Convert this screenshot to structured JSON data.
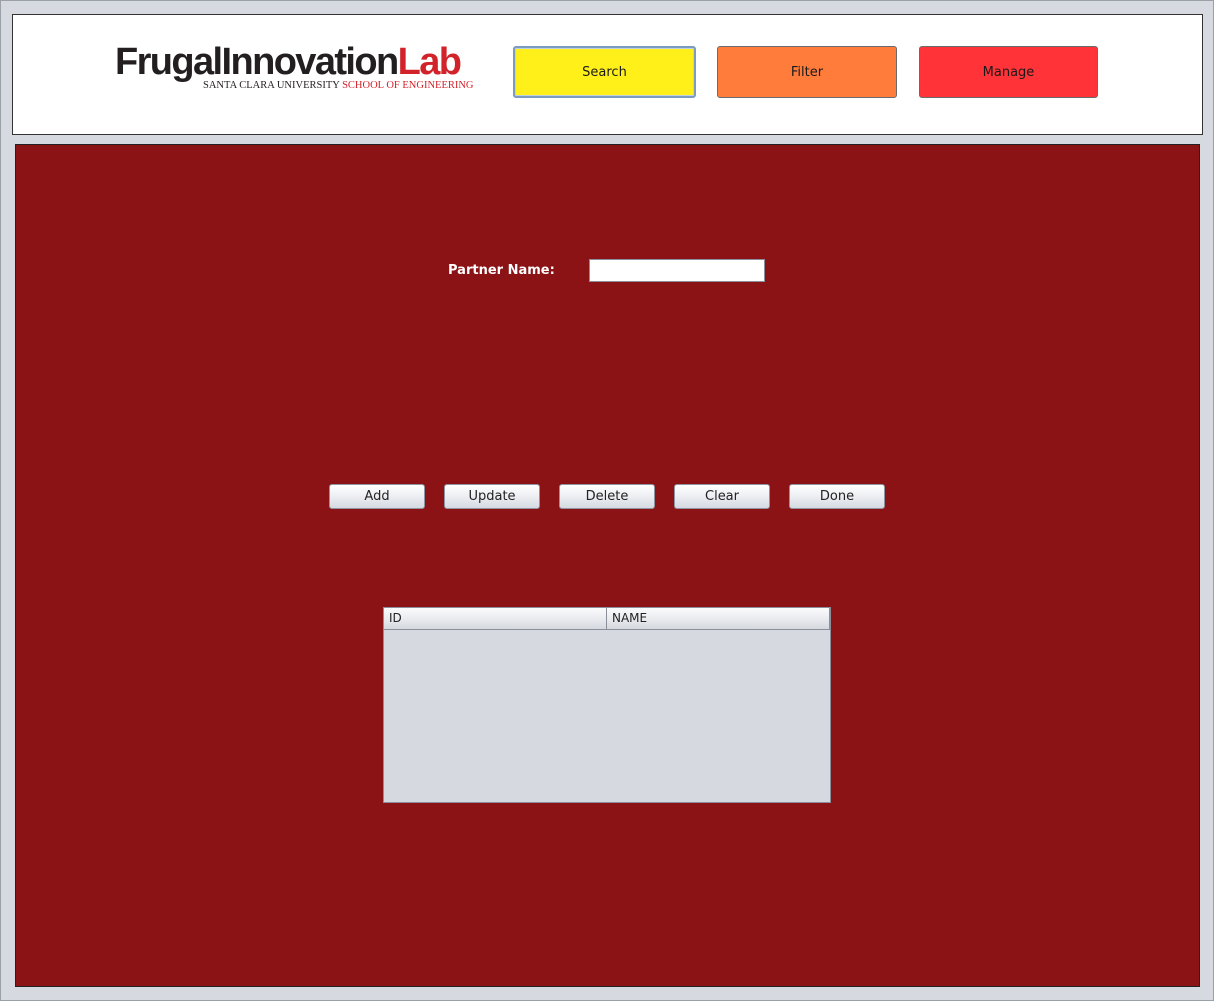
{
  "header": {
    "logo": {
      "main_dark": "Frugal",
      "main_mid": "Innovation",
      "main_red": "Lab",
      "sub_dark": "SANTA CLARA UNIVERSITY",
      "sub_red": "SCHOOL OF ENGINEERING"
    },
    "nav": {
      "search_label": "Search",
      "filter_label": "Filter",
      "manage_label": "Manage"
    }
  },
  "form": {
    "partner_name_label": "Partner Name:",
    "partner_name_value": ""
  },
  "actions": {
    "add_label": "Add",
    "update_label": "Update",
    "delete_label": "Delete",
    "clear_label": "Clear",
    "done_label": "Done"
  },
  "table": {
    "columns": [
      "ID",
      "NAME"
    ],
    "rows": []
  },
  "colors": {
    "search_button": "#fff01a",
    "filter_button": "#ff7c3a",
    "manage_button": "#ff3338",
    "main_panel": "#8b1315",
    "logo_red": "#d2232a"
  }
}
